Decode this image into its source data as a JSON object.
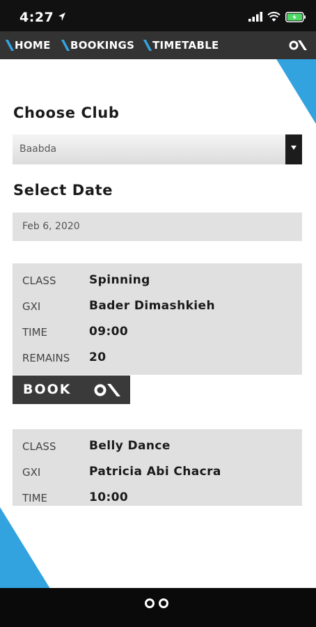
{
  "colors": {
    "accent": "#33a3e0",
    "nav_bg": "#333333",
    "status_bg": "#111111",
    "card_bg": "#e0e0e0",
    "button_bg": "#3a3a3a"
  },
  "status_bar": {
    "time": "4:27",
    "icons": [
      "location-arrow-icon",
      "cellular-signal-icon",
      "wifi-icon",
      "battery-charging-icon"
    ]
  },
  "nav": {
    "items": [
      {
        "label": "HOME"
      },
      {
        "label": "BOOKINGS"
      },
      {
        "label": "TIMETABLE"
      }
    ],
    "logo_icon": "brand-logo-icon"
  },
  "club": {
    "heading": "Choose Club",
    "selected": "Baabda",
    "arrow_icon": "dropdown-arrow-icon"
  },
  "date": {
    "heading": "Select Date",
    "value": "Feb 6, 2020"
  },
  "classes": [
    {
      "rows": [
        {
          "key": "CLASS",
          "value": "Spinning"
        },
        {
          "key": "GXI",
          "value": "Bader Dimashkieh"
        },
        {
          "key": "TIME",
          "value": "09:00"
        },
        {
          "key": "REMAINS",
          "value": "20"
        }
      ],
      "button_label": "BOOK"
    },
    {
      "rows": [
        {
          "key": "CLASS",
          "value": "Belly Dance"
        },
        {
          "key": "GXI",
          "value": "Patricia Abi Chacra"
        },
        {
          "key": "TIME",
          "value": "10:00"
        }
      ]
    }
  ],
  "bottom_bar": {
    "page_indicator_icon": "page-dots-icon"
  }
}
